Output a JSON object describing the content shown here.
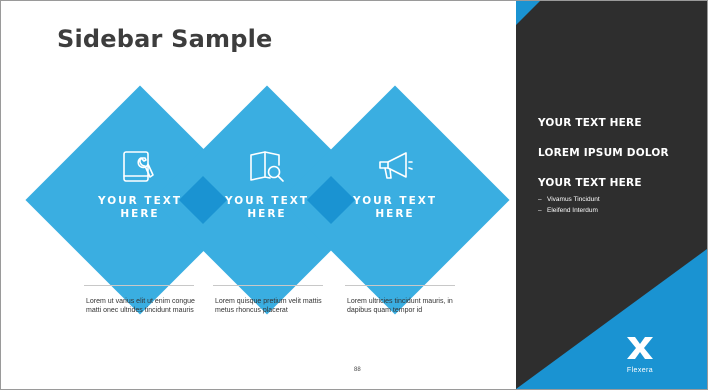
{
  "slide": {
    "title": "Sidebar Sample",
    "page_number": "88"
  },
  "diamonds": [
    {
      "icon": "wrench-tablet-icon",
      "label": "YOUR TEXT HERE"
    },
    {
      "icon": "book-magnifier-icon",
      "label": "YOUR TEXT HERE"
    },
    {
      "icon": "megaphone-icon",
      "label": "YOUR TEXT HERE"
    }
  ],
  "descriptions": [
    "Lorem ut varius elit ut enim congue matti onec ultrides tincidunt mauris",
    "Lorem quisque pretium velit mattis metus rhoncus placerat",
    "Lorem ultricies tincidunt mauris, in dapibus quam tempor id"
  ],
  "sidebar": {
    "heading1": "YOUR TEXT HERE",
    "heading2": "LOREM IPSUM DOLOR",
    "heading3": "YOUR TEXT HERE",
    "bullets": [
      "Vivamus Tincidunt",
      "Eleifend Interdum"
    ],
    "logo_text": "Flexera"
  },
  "colors": {
    "diamond": "#3aaee1",
    "diamond_overlap": "#1a93d2",
    "sidebar": "#2e2e2e",
    "accent": "#1a93d2"
  }
}
